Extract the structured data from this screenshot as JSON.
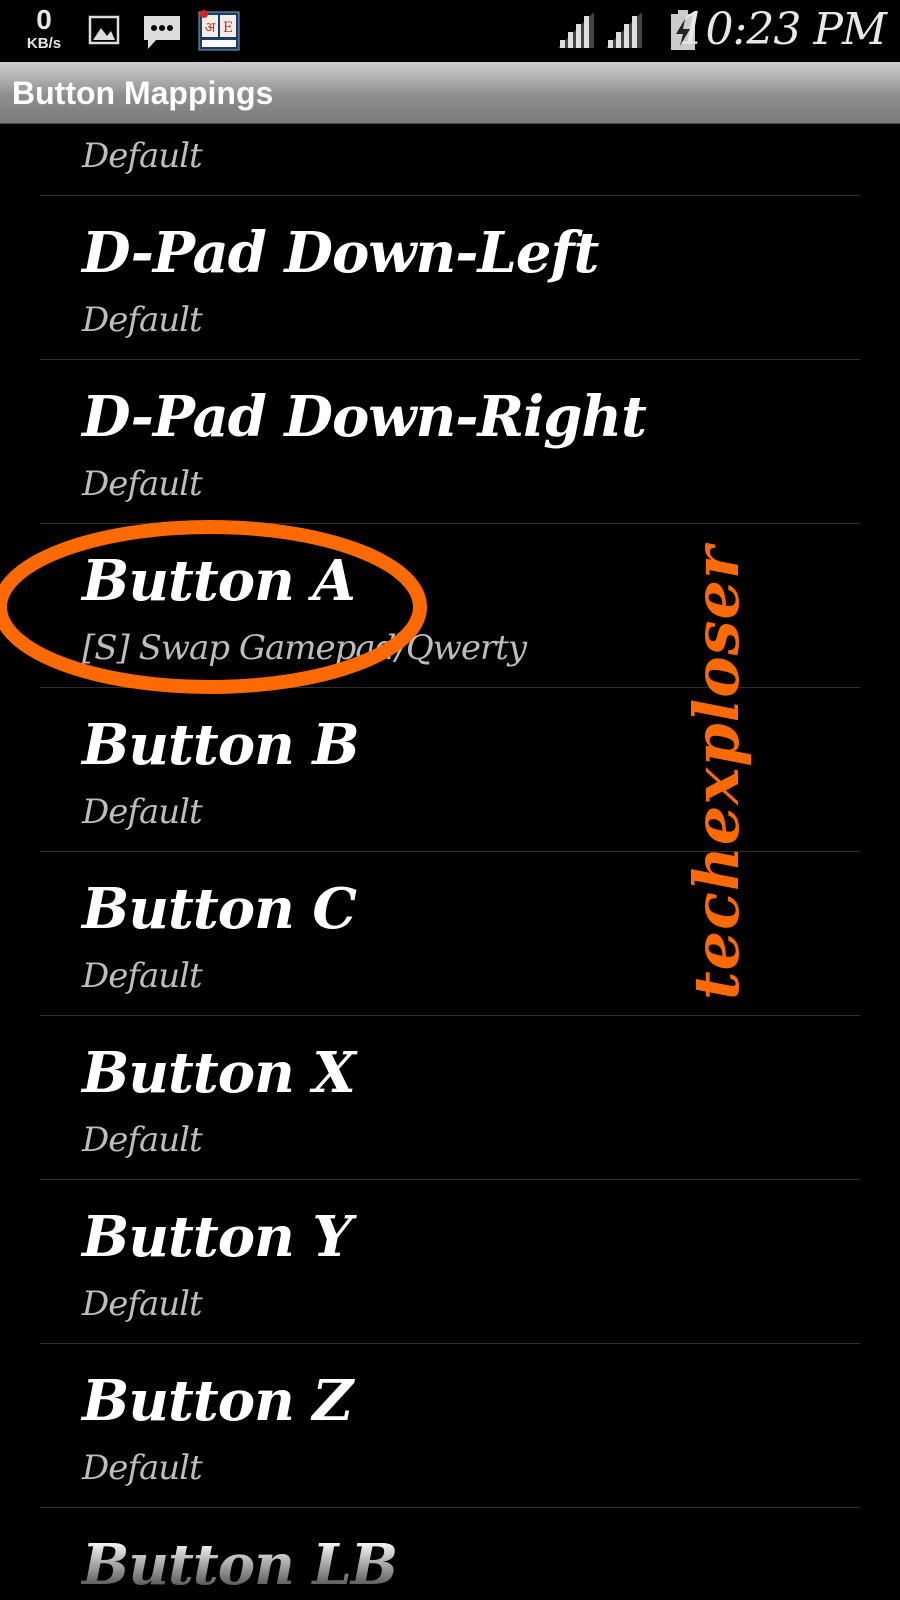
{
  "status_bar": {
    "net_speed_value": "0",
    "net_speed_unit": "KB/s",
    "time": "10:23 PM",
    "icons": [
      "image-icon",
      "message-icon",
      "marathi-keyboard-icon",
      "signal-icon",
      "signal-icon",
      "battery-charging-icon"
    ]
  },
  "action_bar": {
    "title": "Button Mappings"
  },
  "list": {
    "items": [
      {
        "title": "",
        "subtitle": "Default"
      },
      {
        "title": "D-Pad Down-Left",
        "subtitle": "Default"
      },
      {
        "title": "D-Pad Down-Right",
        "subtitle": "Default"
      },
      {
        "title": "Button A",
        "subtitle": "[S] Swap Gamepad/Qwerty"
      },
      {
        "title": "Button B",
        "subtitle": "Default"
      },
      {
        "title": "Button C",
        "subtitle": "Default"
      },
      {
        "title": "Button X",
        "subtitle": "Default"
      },
      {
        "title": "Button Y",
        "subtitle": "Default"
      },
      {
        "title": "Button Z",
        "subtitle": "Default"
      },
      {
        "title": "Button LB",
        "subtitle": ""
      }
    ]
  },
  "watermark": "techexploser",
  "colors": {
    "highlight": "#ff6a00",
    "background": "#000000",
    "subtitle": "#bdbdbd"
  }
}
